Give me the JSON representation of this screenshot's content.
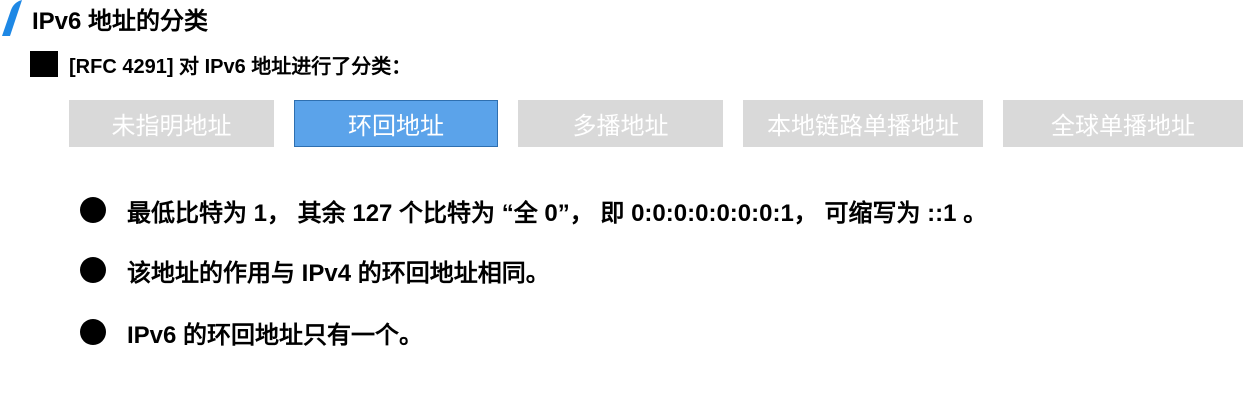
{
  "header": {
    "title": "IPv6 地址的分类",
    "accent_color": "#1e88e5",
    "accent_icon": "slanted-bar-icon"
  },
  "subtitle": {
    "bullet_icon": "black-square-icon",
    "text": "[RFC 4291] 对 IPv6 地址进行了分类："
  },
  "tabs": [
    {
      "label": "未指明地址",
      "active": false
    },
    {
      "label": "环回地址",
      "active": true
    },
    {
      "label": "多播地址",
      "active": false
    },
    {
      "label": "本地链路单播地址",
      "active": false
    },
    {
      "label": "全球单播地址",
      "active": false
    }
  ],
  "colors": {
    "tab_inactive": "#d9d9d9",
    "tab_active": "#5ba3ea",
    "tab_text": "#ffffff"
  },
  "bullets": [
    {
      "icon": "black-dot-icon",
      "text": "最低比特为 1， 其余 127 个比特为 “全 0”， 即 0:0:0:0:0:0:0:1， 可缩写为 ::1 。"
    },
    {
      "icon": "black-dot-icon",
      "text": "该地址的作用与 IPv4 的环回地址相同。"
    },
    {
      "icon": "black-dot-icon",
      "text": "IPv6 的环回地址只有一个。"
    }
  ]
}
